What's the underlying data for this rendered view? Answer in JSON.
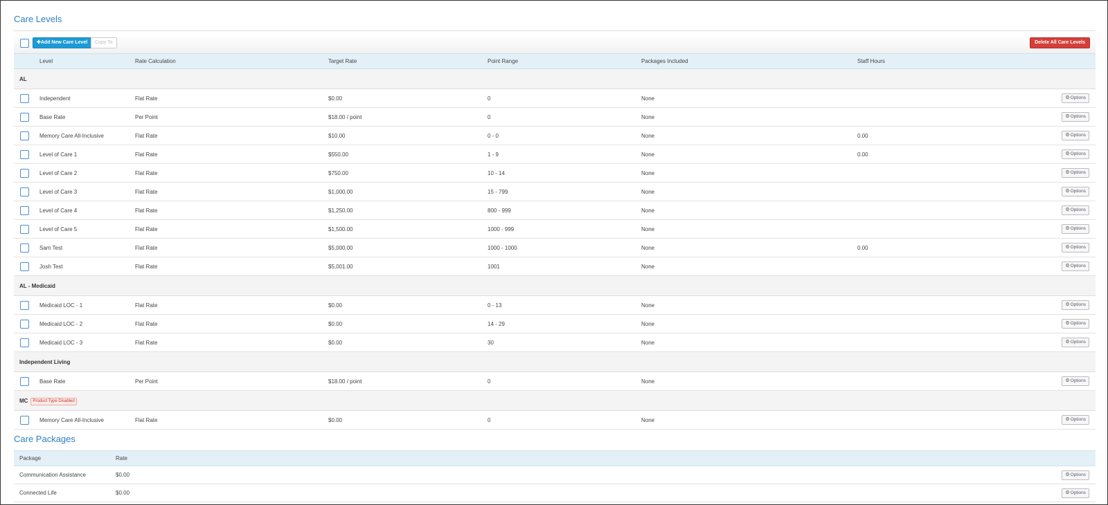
{
  "care_levels": {
    "title": "Care Levels",
    "toolbar": {
      "add_label": "✚Add New Care Level",
      "copy_label": "Copy To",
      "delete_label": "Delete All Care Levels"
    },
    "columns": [
      "Level",
      "Rate Calculation",
      "Target Rate",
      "Point Range",
      "Packages Included",
      "Staff Hours"
    ],
    "option_label": "Options",
    "groups": [
      {
        "name": "AL",
        "badge": "",
        "rows": [
          {
            "level": "Independent",
            "rate_calc": "Flat Rate",
            "target": "$0.00",
            "points": "0",
            "packages": "None",
            "staff": ""
          },
          {
            "level": "Base Rate",
            "rate_calc": "Per Point",
            "target": "$18.00 / point",
            "points": "0",
            "packages": "None",
            "staff": ""
          },
          {
            "level": "Memory Care All-Inclusive",
            "rate_calc": "Flat Rate",
            "target": "$10.00",
            "points": "0 - 0",
            "packages": "None",
            "staff": "0.00"
          },
          {
            "level": "Level of Care 1",
            "rate_calc": "Flat Rate",
            "target": "$550.00",
            "points": "1 - 9",
            "packages": "None",
            "staff": "0.00"
          },
          {
            "level": "Level of Care 2",
            "rate_calc": "Flat Rate",
            "target": "$750.00",
            "points": "10 - 14",
            "packages": "None",
            "staff": ""
          },
          {
            "level": "Level of Care 3",
            "rate_calc": "Flat Rate",
            "target": "$1,000.00",
            "points": "15 - 799",
            "packages": "None",
            "staff": ""
          },
          {
            "level": "Level of Care 4",
            "rate_calc": "Flat Rate",
            "target": "$1,250.00",
            "points": "800 - 999",
            "packages": "None",
            "staff": ""
          },
          {
            "level": "Level of Care 5",
            "rate_calc": "Flat Rate",
            "target": "$1,500.00",
            "points": "1000 - 999",
            "packages": "None",
            "staff": ""
          },
          {
            "level": "Sam Test",
            "rate_calc": "Flat Rate",
            "target": "$5,000.00",
            "points": "1000 - 1000",
            "packages": "None",
            "staff": "0.00"
          },
          {
            "level": "Josh Test",
            "rate_calc": "Flat Rate",
            "target": "$5,001.00",
            "points": "1001",
            "packages": "None",
            "staff": ""
          }
        ]
      },
      {
        "name": "AL - Medicaid",
        "badge": "",
        "rows": [
          {
            "level": "Medicaid LOC - 1",
            "rate_calc": "Flat Rate",
            "target": "$0.00",
            "points": "0 - 13",
            "packages": "None",
            "staff": ""
          },
          {
            "level": "Medicaid LOC - 2",
            "rate_calc": "Flat Rate",
            "target": "$0.00",
            "points": "14 - 29",
            "packages": "None",
            "staff": ""
          },
          {
            "level": "Medicaid LOC - 3",
            "rate_calc": "Flat Rate",
            "target": "$0.00",
            "points": "30",
            "packages": "None",
            "staff": ""
          }
        ]
      },
      {
        "name": "Independent Living",
        "badge": "",
        "rows": [
          {
            "level": "Base Rate",
            "rate_calc": "Per Point",
            "target": "$18.00 / point",
            "points": "0",
            "packages": "None",
            "staff": ""
          }
        ]
      },
      {
        "name": "MC",
        "badge": "Product Type Disabled",
        "rows": [
          {
            "level": "Memory Care All-Inclusive",
            "rate_calc": "Flat Rate",
            "target": "$0.00",
            "points": "0",
            "packages": "None",
            "staff": ""
          }
        ]
      }
    ]
  },
  "care_packages": {
    "title": "Care Packages",
    "columns": [
      "Package",
      "Rate"
    ],
    "rows": [
      {
        "package": "Communication Assistance",
        "rate": "$0.00"
      },
      {
        "package": "Connected Life",
        "rate": "$0.00"
      }
    ]
  },
  "colors": {
    "accent": "#1d9ad6",
    "title": "#2f80c0",
    "danger": "#d43f3a",
    "header_bg": "#e4f0f7",
    "group_bg": "#f4f4f4"
  },
  "icons": {
    "options": "gear-icon",
    "add": "plus-icon"
  }
}
